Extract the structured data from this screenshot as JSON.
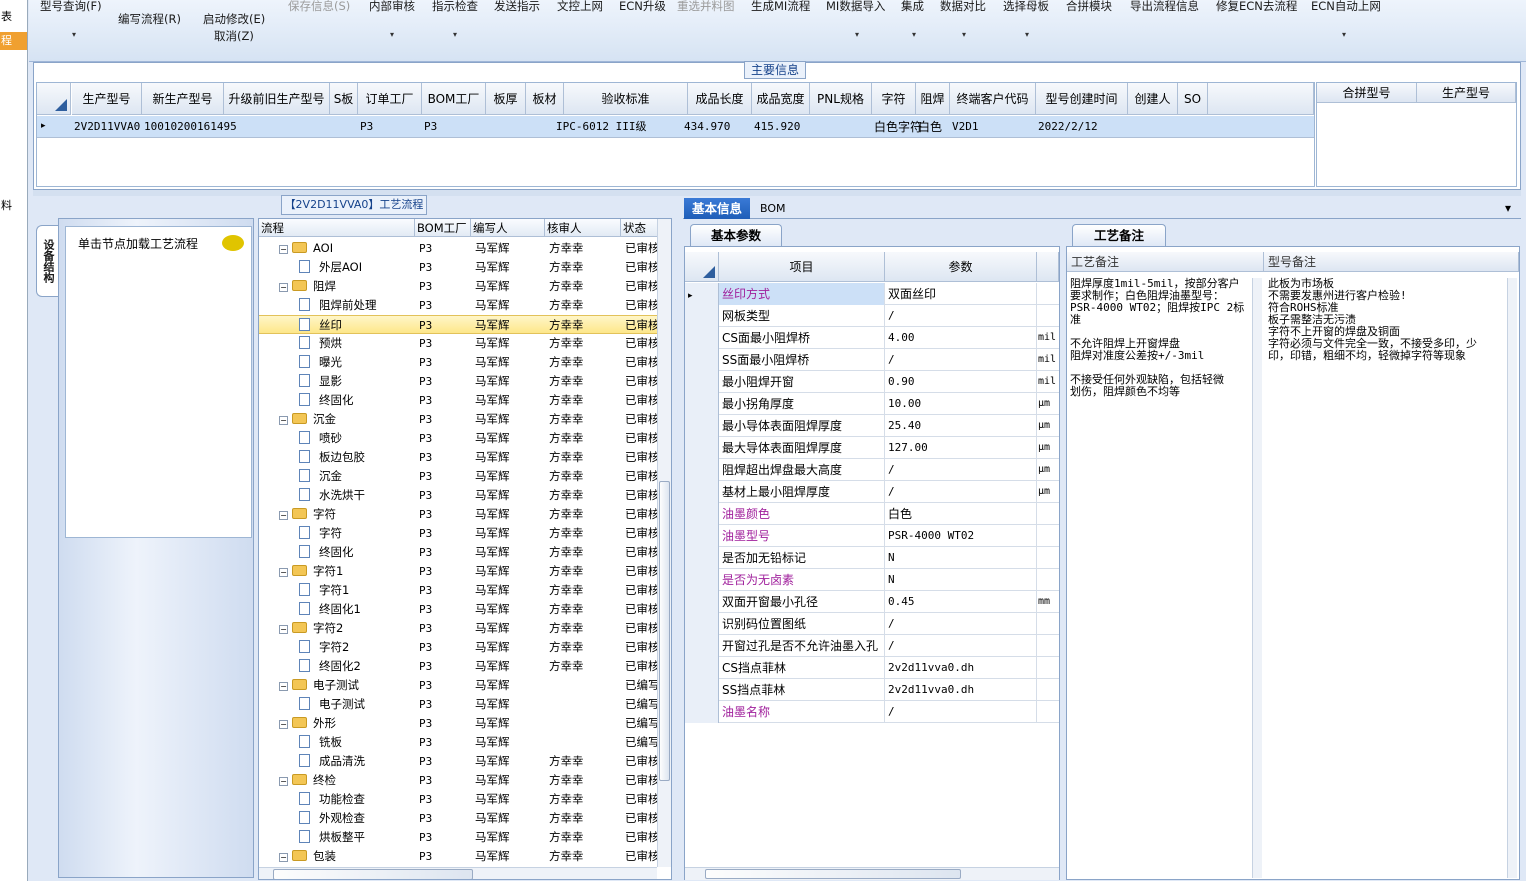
{
  "left_strip": {
    "items": [
      "表",
      "程"
    ],
    "partial": "料"
  },
  "toolbar": {
    "items": [
      {
        "label": "型号查询(F)",
        "disabled": false
      },
      {
        "label": "编写流程(R)",
        "disabled": false
      },
      {
        "label": "启动修改(E)",
        "disabled": false
      },
      {
        "label": "取消(Z)",
        "disabled": false
      },
      {
        "label": "保存信息(S)",
        "disabled": true
      },
      {
        "label": "内部审核",
        "disabled": false
      },
      {
        "label": "指示检查",
        "disabled": false
      },
      {
        "label": "发送指示",
        "disabled": false
      },
      {
        "label": "文控上网",
        "disabled": false
      },
      {
        "label": "ECN升级",
        "disabled": false
      },
      {
        "label": "重选并料图",
        "disabled": true
      },
      {
        "label": "生成MI流程",
        "disabled": false
      },
      {
        "label": "MI数据导入",
        "disabled": false
      },
      {
        "label": "集成",
        "disabled": false
      },
      {
        "label": "数据对比",
        "disabled": false
      },
      {
        "label": "选择母板",
        "disabled": false
      },
      {
        "label": "合拼模块",
        "disabled": false
      },
      {
        "label": "导出流程信息",
        "disabled": false
      },
      {
        "label": "修复ECN去流程",
        "disabled": false
      },
      {
        "label": "ECN自动上网",
        "disabled": false
      }
    ],
    "dropdown_glyph": "▾"
  },
  "main_info": {
    "title": "主要信息",
    "columns": [
      "生产型号",
      "新生产型号",
      "升级前旧生产型号",
      "S板",
      "订单工厂",
      "BOM工厂",
      "板厚",
      "板材",
      "验收标准",
      "成品长度",
      "成品宽度",
      "PNL规格",
      "字符",
      "阻焊",
      "终端客户代码",
      "型号创建时间",
      "创建人",
      "SO"
    ],
    "row": {
      "生产型号": "2V2D11VVA0",
      "新生产型号": "10010200161495",
      "升级前旧生产型号": "",
      "S板": "",
      "订单工厂": "P3",
      "BOM工厂": "P3",
      "板厚": "",
      "板材": "",
      "验收标准": "IPC-6012 III级",
      "成品长度": "434.970",
      "成品宽度": "415.920",
      "PNL规格": "",
      "字符": "白色字符",
      "阻焊": "白色",
      "终端客户代码": "V2D1",
      "型号创建时间": "2022/2/12",
      "创建人": "",
      "SO": ""
    },
    "row_marker": "▸",
    "merge_columns": [
      "合拼型号",
      "生产型号"
    ]
  },
  "nav": {
    "tab_label": "设备结构",
    "hint": "单击节点加载工艺流程"
  },
  "tree": {
    "title": "【2V2D11VVA0】工艺流程",
    "columns": [
      "流程",
      "BOM工厂",
      "编写人",
      "核审人",
      "状态"
    ],
    "rows": [
      {
        "name": "AOI",
        "level": 0,
        "type": "folder",
        "factory": "P3",
        "writer": "马军辉",
        "reviewer": "方幸幸",
        "status": "已审核"
      },
      {
        "name": "外层AOI",
        "level": 1,
        "type": "doc",
        "factory": "P3",
        "writer": "马军辉",
        "reviewer": "方幸幸",
        "status": "已审核"
      },
      {
        "name": "阻焊",
        "level": 0,
        "type": "folder",
        "factory": "P3",
        "writer": "马军辉",
        "reviewer": "方幸幸",
        "status": "已审核"
      },
      {
        "name": "阻焊前处理",
        "level": 1,
        "type": "doc",
        "factory": "P3",
        "writer": "马军辉",
        "reviewer": "方幸幸",
        "status": "已审核"
      },
      {
        "name": "丝印",
        "level": 1,
        "type": "doc",
        "factory": "P3",
        "writer": "马军辉",
        "reviewer": "方幸幸",
        "status": "已审核",
        "selected": true
      },
      {
        "name": "预烘",
        "level": 1,
        "type": "doc",
        "factory": "P3",
        "writer": "马军辉",
        "reviewer": "方幸幸",
        "status": "已审核"
      },
      {
        "name": "曝光",
        "level": 1,
        "type": "doc",
        "factory": "P3",
        "writer": "马军辉",
        "reviewer": "方幸幸",
        "status": "已审核"
      },
      {
        "name": "显影",
        "level": 1,
        "type": "doc",
        "factory": "P3",
        "writer": "马军辉",
        "reviewer": "方幸幸",
        "status": "已审核"
      },
      {
        "name": "终固化",
        "level": 1,
        "type": "doc",
        "factory": "P3",
        "writer": "马军辉",
        "reviewer": "方幸幸",
        "status": "已审核"
      },
      {
        "name": "沉金",
        "level": 0,
        "type": "folder",
        "factory": "P3",
        "writer": "马军辉",
        "reviewer": "方幸幸",
        "status": "已审核"
      },
      {
        "name": "喷砂",
        "level": 1,
        "type": "doc",
        "factory": "P3",
        "writer": "马军辉",
        "reviewer": "方幸幸",
        "status": "已审核"
      },
      {
        "name": "板边包胶",
        "level": 1,
        "type": "doc",
        "factory": "P3",
        "writer": "马军辉",
        "reviewer": "方幸幸",
        "status": "已审核"
      },
      {
        "name": "沉金",
        "level": 1,
        "type": "doc",
        "factory": "P3",
        "writer": "马军辉",
        "reviewer": "方幸幸",
        "status": "已审核"
      },
      {
        "name": "水洗烘干",
        "level": 1,
        "type": "doc",
        "factory": "P3",
        "writer": "马军辉",
        "reviewer": "方幸幸",
        "status": "已审核"
      },
      {
        "name": "字符",
        "level": 0,
        "type": "folder",
        "factory": "P3",
        "writer": "马军辉",
        "reviewer": "方幸幸",
        "status": "已审核"
      },
      {
        "name": "字符",
        "level": 1,
        "type": "doc",
        "factory": "P3",
        "writer": "马军辉",
        "reviewer": "方幸幸",
        "status": "已审核"
      },
      {
        "name": "终固化",
        "level": 1,
        "type": "doc",
        "factory": "P3",
        "writer": "马军辉",
        "reviewer": "方幸幸",
        "status": "已审核"
      },
      {
        "name": "字符1",
        "level": 0,
        "type": "folder",
        "factory": "P3",
        "writer": "马军辉",
        "reviewer": "方幸幸",
        "status": "已审核"
      },
      {
        "name": "字符1",
        "level": 1,
        "type": "doc",
        "factory": "P3",
        "writer": "马军辉",
        "reviewer": "方幸幸",
        "status": "已审核"
      },
      {
        "name": "终固化1",
        "level": 1,
        "type": "doc",
        "factory": "P3",
        "writer": "马军辉",
        "reviewer": "方幸幸",
        "status": "已审核"
      },
      {
        "name": "字符2",
        "level": 0,
        "type": "folder",
        "factory": "P3",
        "writer": "马军辉",
        "reviewer": "方幸幸",
        "status": "已审核"
      },
      {
        "name": "字符2",
        "level": 1,
        "type": "doc",
        "factory": "P3",
        "writer": "马军辉",
        "reviewer": "方幸幸",
        "status": "已审核"
      },
      {
        "name": "终固化2",
        "level": 1,
        "type": "doc",
        "factory": "P3",
        "writer": "马军辉",
        "reviewer": "方幸幸",
        "status": "已审核"
      },
      {
        "name": "电子测试",
        "level": 0,
        "type": "folder",
        "factory": "P3",
        "writer": "马军辉",
        "reviewer": "",
        "status": "已编写"
      },
      {
        "name": "电子测试",
        "level": 1,
        "type": "doc",
        "factory": "P3",
        "writer": "马军辉",
        "reviewer": "",
        "status": "已编写"
      },
      {
        "name": "外形",
        "level": 0,
        "type": "folder",
        "factory": "P3",
        "writer": "马军辉",
        "reviewer": "",
        "status": "已编写"
      },
      {
        "name": "铣板",
        "level": 1,
        "type": "doc",
        "factory": "P3",
        "writer": "马军辉",
        "reviewer": "",
        "status": "已编写"
      },
      {
        "name": "成品清洗",
        "level": 1,
        "type": "doc",
        "factory": "P3",
        "writer": "马军辉",
        "reviewer": "方幸幸",
        "status": "已审核"
      },
      {
        "name": "终检",
        "level": 0,
        "type": "folder",
        "factory": "P3",
        "writer": "马军辉",
        "reviewer": "方幸幸",
        "status": "已审核"
      },
      {
        "name": "功能检查",
        "level": 1,
        "type": "doc",
        "factory": "P3",
        "writer": "马军辉",
        "reviewer": "方幸幸",
        "status": "已审核"
      },
      {
        "name": "外观检查",
        "level": 1,
        "type": "doc",
        "factory": "P3",
        "writer": "马军辉",
        "reviewer": "方幸幸",
        "status": "已审核"
      },
      {
        "name": "烘板整平",
        "level": 1,
        "type": "doc",
        "factory": "P3",
        "writer": "马军辉",
        "reviewer": "方幸幸",
        "status": "已审核"
      },
      {
        "name": "包装",
        "level": 0,
        "type": "folder",
        "factory": "P3",
        "writer": "马军辉",
        "reviewer": "方幸幸",
        "status": "已审核"
      }
    ]
  },
  "detail_tabs": {
    "active": "基本信息",
    "other": "BOM",
    "menu_glyph": "▾"
  },
  "params": {
    "tab": "基本参数",
    "columns": [
      "项目",
      "参数"
    ],
    "row_marker": "▸",
    "rows": [
      {
        "item": "丝印方式",
        "value": "双面丝印",
        "unit": "",
        "highlight": true
      },
      {
        "item": "网板类型",
        "value": "/",
        "unit": "",
        "highlight": false
      },
      {
        "item": "CS面最小阻焊桥",
        "value": "4.00",
        "unit": "mil",
        "highlight": false
      },
      {
        "item": "SS面最小阻焊桥",
        "value": "/",
        "unit": "mil",
        "highlight": false
      },
      {
        "item": "最小阻焊开窗",
        "value": "0.90",
        "unit": "mil",
        "highlight": false
      },
      {
        "item": "最小拐角厚度",
        "value": "10.00",
        "unit": "μm",
        "highlight": false
      },
      {
        "item": "最小导体表面阻焊厚度",
        "value": "25.40",
        "unit": "μm",
        "highlight": false
      },
      {
        "item": "最大导体表面阻焊厚度",
        "value": "127.00",
        "unit": "μm",
        "highlight": false
      },
      {
        "item": "阻焊超出焊盘最大高度",
        "value": "/",
        "unit": "μm",
        "highlight": false
      },
      {
        "item": "基材上最小阻焊厚度",
        "value": "/",
        "unit": "μm",
        "highlight": false
      },
      {
        "item": "油墨颜色",
        "value": "白色",
        "unit": "",
        "highlight": true
      },
      {
        "item": "油墨型号",
        "value": "PSR-4000 WT02",
        "unit": "",
        "highlight": true
      },
      {
        "item": "是否加无铅标记",
        "value": "N",
        "unit": "",
        "highlight": false
      },
      {
        "item": "是否为无卤素",
        "value": "N",
        "unit": "",
        "highlight": true
      },
      {
        "item": "双面开窗最小孔径",
        "value": "0.45",
        "unit": "mm",
        "highlight": false
      },
      {
        "item": "识别码位置图纸",
        "value": "/",
        "unit": "",
        "highlight": false
      },
      {
        "item": "开窗过孔是否不允许油墨入孔",
        "value": "/",
        "unit": "",
        "highlight": false
      },
      {
        "item": "CS挡点菲林",
        "value": "2v2d11vva0.dh",
        "unit": "",
        "highlight": false
      },
      {
        "item": "SS挡点菲林",
        "value": "2v2d11vva0.dh",
        "unit": "",
        "highlight": false
      },
      {
        "item": "油墨名称",
        "value": "/",
        "unit": "",
        "highlight": true
      }
    ]
  },
  "notes": {
    "tab": "工艺备注",
    "columns": [
      "工艺备注",
      "型号备注"
    ],
    "process_note": "阻焊厚度1mil-5mil，按部分客户\n要求制作；白色阻焊油墨型号：\nPSR-4000 WT02；阻焊按IPC 2标\n准\n\n不允许阻焊上开窗焊盘\n阻焊对准度公差按+/-3mil\n\n不接受任何外观缺陷，包括轻微\n划伤，阻焊颜色不均等",
    "model_note": "此板为市场板\n不需要发惠州进行客户检验!\n符合ROHS标准\n板子需整洁无污渍\n字符不上开窗的焊盘及铜面\n字符必须与文件完全一致，不接受多印，少\n印，印错，粗细不均，轻微掉字符等现象"
  },
  "colors": {
    "selected_row": "#cce0f7",
    "highlight_text": "#a0209c",
    "tab_active": "#1f5eb8",
    "tree_selected": "#fde78a"
  }
}
